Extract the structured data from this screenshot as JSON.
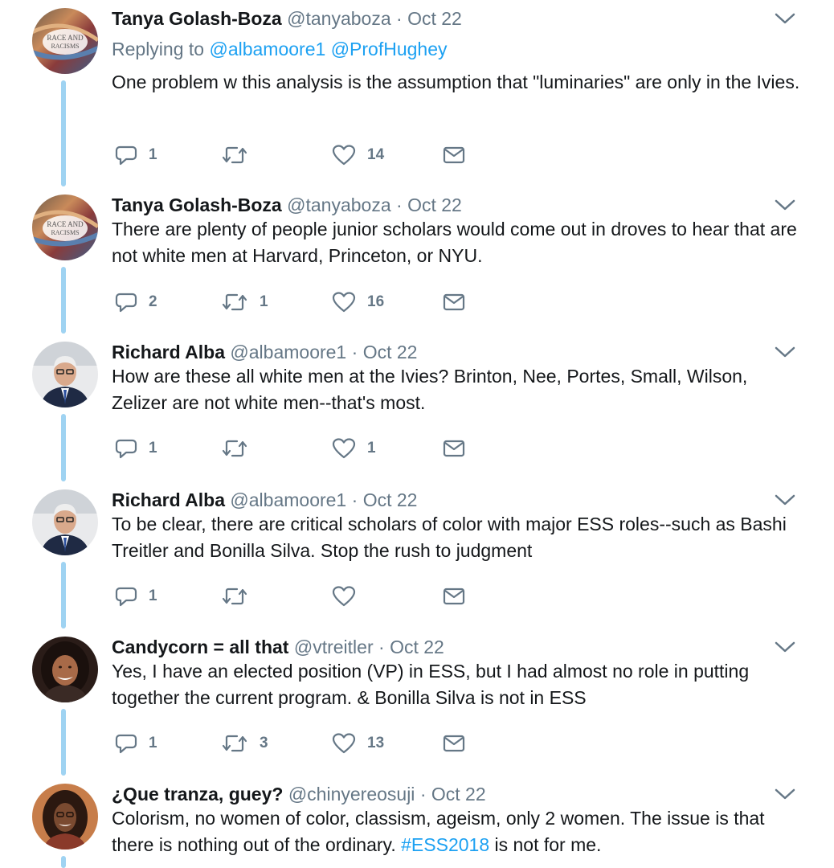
{
  "tweets": [
    {
      "name": "Tanya Golash-Boza",
      "handle": "@tanyaboza",
      "dot": "·",
      "time": "Oct 22",
      "reply_prefix": "Replying to",
      "reply_mentions": [
        "@albamoore1",
        "@ProfHughey"
      ],
      "text": "One problem w this analysis is the assumption that \"luminaries\" are only in the Ivies.",
      "replies": "1",
      "retweets": "",
      "likes": "14",
      "avatar_text": [
        "RACE AND",
        "RACISMS"
      ]
    },
    {
      "name": "Tanya Golash-Boza",
      "handle": "@tanyaboza",
      "dot": "·",
      "time": "Oct 22",
      "text": "There are plenty of people junior scholars would come out in droves to hear that are not white men at Harvard, Princeton, or NYU.",
      "replies": "2",
      "retweets": "1",
      "likes": "16",
      "avatar_text": [
        "RACE AND",
        "RACISMS"
      ]
    },
    {
      "name": "Richard Alba",
      "handle": "@albamoore1",
      "dot": "·",
      "time": "Oct 22",
      "text": "How are these all white men at the Ivies?  Brinton, Nee, Portes, Small, Wilson, Zelizer are not white men--that's most.",
      "replies": "1",
      "retweets": "",
      "likes": "1"
    },
    {
      "name": "Richard Alba",
      "handle": "@albamoore1",
      "dot": "·",
      "time": "Oct 22",
      "text": "To be clear, there are critical scholars of color with major ESS roles--such as Bashi Treitler and Bonilla Silva.  Stop the rush to judgment",
      "replies": "1",
      "retweets": "",
      "likes": ""
    },
    {
      "name": "Candycorn = all that",
      "handle": "@vtreitler",
      "dot": "·",
      "time": "Oct 22",
      "text": "Yes, I have an elected position (VP) in ESS, but I had almost no role in putting together the current program. & Bonilla Silva is not in ESS",
      "replies": "1",
      "retweets": "3",
      "likes": "13"
    },
    {
      "name": "¿Que tranza, guey?",
      "handle": "@chinyereosuji",
      "dot": "·",
      "time": "Oct 22",
      "text_before": "Colorism, no women of color, classism, ageism, only 2 women. The issue is that there is nothing out of the ordinary. ",
      "hashtag": "#ESS2018",
      "text_after": " is not for me."
    }
  ],
  "icons": {
    "reply": "reply-icon",
    "retweet": "retweet-icon",
    "like": "heart-icon",
    "dm": "envelope-icon",
    "more": "chevron-down-icon"
  },
  "colors": {
    "accent": "#1da1f2",
    "thread_line": "#9fd3f2",
    "secondary_text": "#657786",
    "icon": "#657786"
  }
}
